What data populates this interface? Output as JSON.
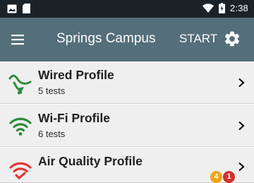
{
  "status_bar": {
    "time": "2:38",
    "left_icons": [
      "image-icon",
      "sim-card-icon"
    ],
    "right_icons": [
      "wifi-icon",
      "battery-icon"
    ]
  },
  "app_bar": {
    "menu_icon": "hamburger-menu-icon",
    "title": "Springs Campus",
    "start_label": "START",
    "settings_icon": "gear-icon",
    "background": "#546e7a"
  },
  "profiles": [
    {
      "title": "Wired Profile",
      "subtitle": "5 tests",
      "icon": "ethernet-cable-icon",
      "icon_color": "#2e8b3e"
    },
    {
      "title": "Wi-Fi Profile",
      "subtitle": "6 tests",
      "icon": "wifi-icon",
      "icon_color": "#2e8b3e"
    },
    {
      "title": "Air Quality Profile",
      "subtitle": "",
      "icon": "wifi-check-icon",
      "icon_color": "#e53935",
      "badges": [
        {
          "value": "4",
          "color": "#f0a21a"
        },
        {
          "value": "1",
          "color": "#d32f2f"
        }
      ]
    }
  ]
}
